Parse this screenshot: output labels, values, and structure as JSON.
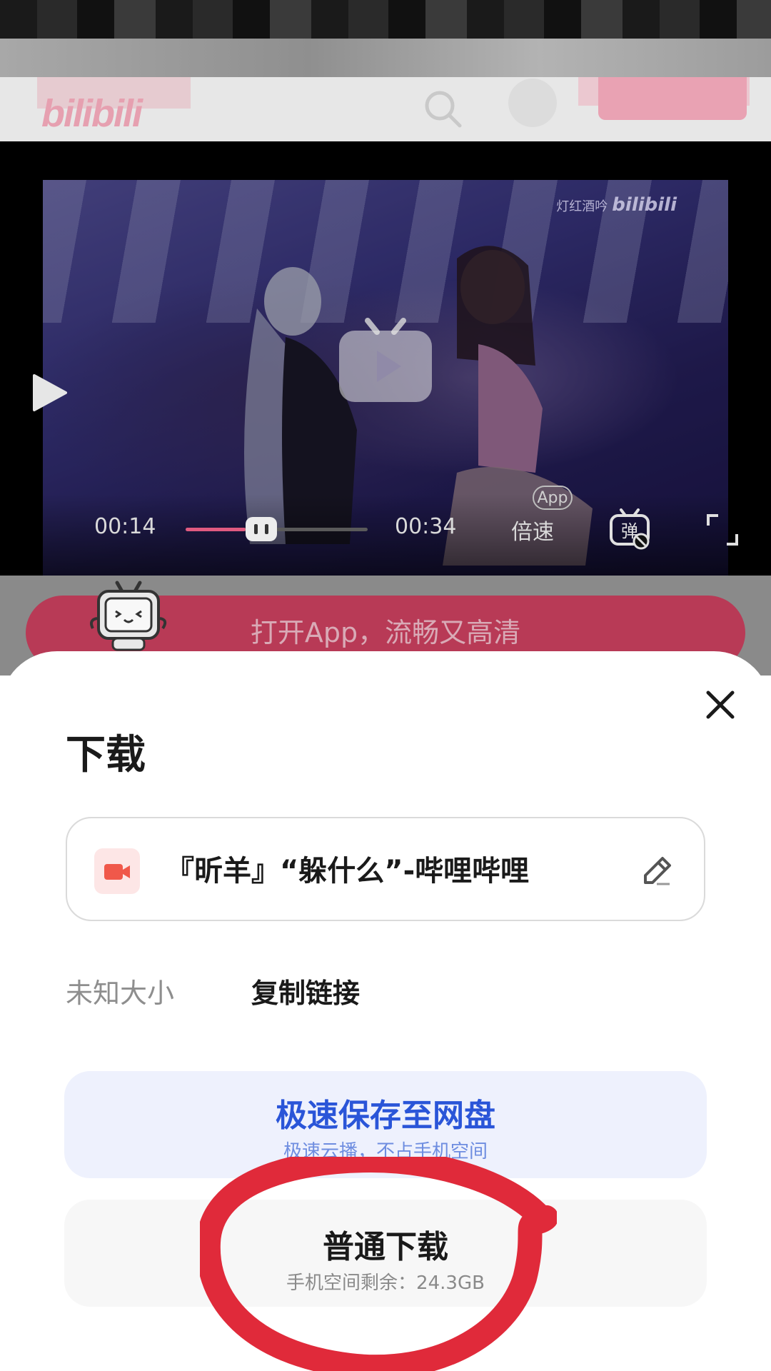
{
  "site": {
    "logo_text": "bilibili"
  },
  "player": {
    "watermark_text": "灯红酒吟",
    "watermark_logo": "bilibili",
    "current_time": "00:14",
    "total_time": "00:34",
    "speed_label": "倍速",
    "app_chip": "App",
    "progress": 0.33
  },
  "banner": {
    "open_app_text": "打开App，流畅又高清"
  },
  "sheet": {
    "title": "下载",
    "file_name": "『昕羊』“躲什么”-哔哩哔哩",
    "size_label": "未知大小",
    "copy_link": "复制链接",
    "cloud_button": {
      "title": "极速保存至网盘",
      "subtitle": "极速云播，不占手机空间"
    },
    "normal_button": {
      "title": "普通下载",
      "subtitle": "手机空间剩余：24.3GB"
    }
  },
  "colors": {
    "accent_blue": "#2a55d8",
    "bilibili_pink": "#b83a56",
    "annotation_red": "#e02a3a"
  },
  "icons": [
    "search-icon",
    "avatar",
    "play-icon",
    "danmaku-icon",
    "fullscreen-icon",
    "close-icon",
    "video-file-icon",
    "edit-icon"
  ]
}
